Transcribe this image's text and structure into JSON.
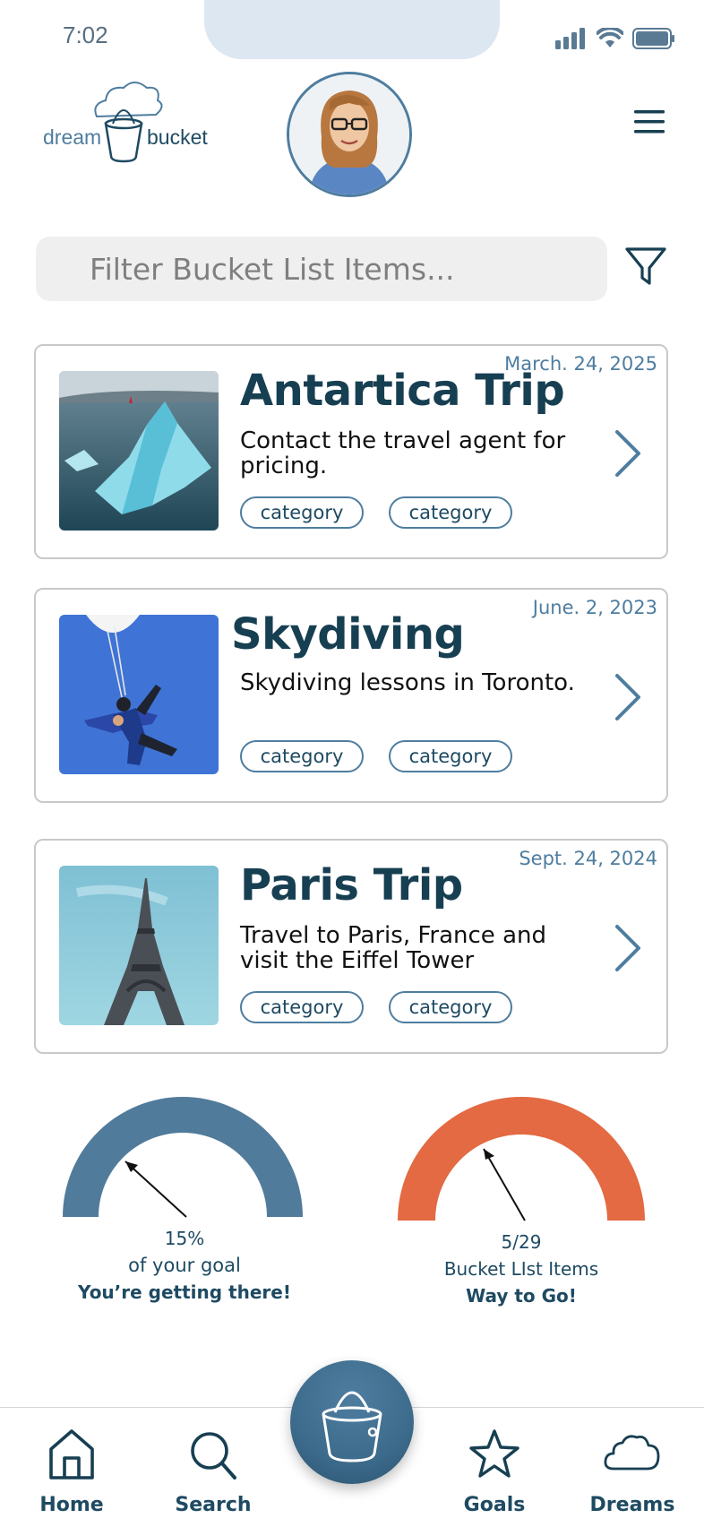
{
  "status_bar": {
    "time": "7:02"
  },
  "header": {
    "logo_left": "dream",
    "logo_right": "bucket",
    "avatar_icon": "profile-photo",
    "menu_icon": "hamburger-menu-icon"
  },
  "filter": {
    "placeholder": "Filter Bucket List Items...",
    "filter_icon": "funnel-icon"
  },
  "items": [
    {
      "date": "March. 24, 2025",
      "title": "Antartica Trip",
      "description": "Contact the travel agent for pricing.",
      "categories": [
        "category",
        "category"
      ],
      "thumb": "iceberg-image"
    },
    {
      "date": "June. 2, 2023",
      "title": "Skydiving",
      "description": "Skydiving lessons in Toronto.",
      "categories": [
        "category",
        "category"
      ],
      "thumb": "skydiver-image"
    },
    {
      "date": "Sept. 24, 2024",
      "title": "Paris Trip",
      "description": "Travel to Paris, France and visit the Eiffel Tower",
      "categories": [
        "category",
        "category"
      ],
      "thumb": "eiffel-tower-image"
    }
  ],
  "gauges": [
    {
      "value": "15%",
      "caption": "of your goal",
      "message": "You’re getting there!",
      "color": "#517b9b"
    },
    {
      "value": "5/29",
      "caption": "Bucket LIst Items",
      "message": "Way to Go!",
      "color": "#e36a42"
    }
  ],
  "nav": {
    "home": "Home",
    "search": "Search",
    "goals": "Goals",
    "dreams": "Dreams",
    "center_icon": "bucket-icon"
  },
  "colors": {
    "primary": "#4e7d9f",
    "dark": "#173f52",
    "accent": "#e36a42"
  }
}
